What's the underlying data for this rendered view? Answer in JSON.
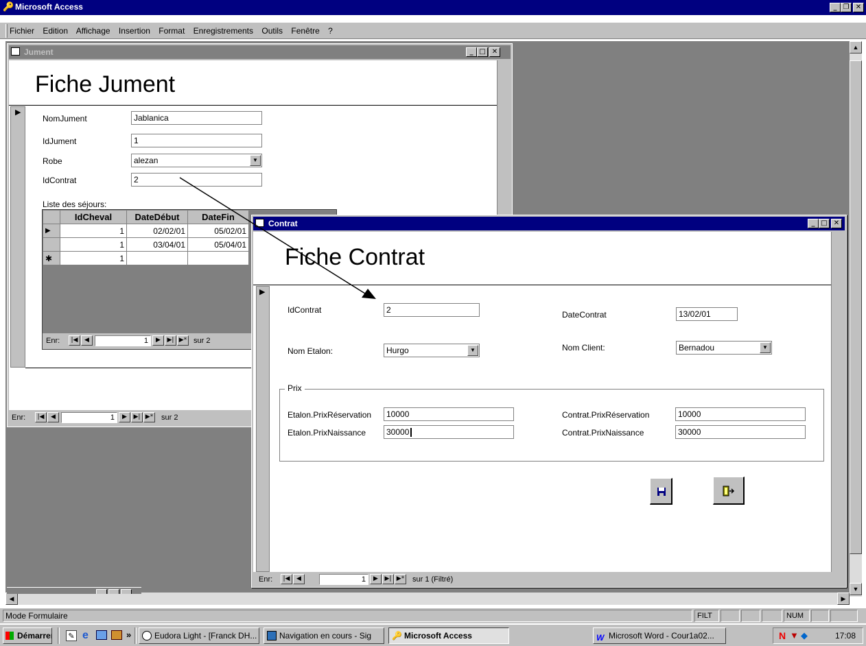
{
  "app": {
    "title": "Microsoft Access"
  },
  "menu": [
    "Fichier",
    "Edition",
    "Affichage",
    "Insertion",
    "Format",
    "Enregistrements",
    "Outils",
    "Fenêtre",
    "?"
  ],
  "jument": {
    "window_title": "Jument",
    "heading": "Fiche Jument",
    "fields": [
      {
        "label": "NomJument",
        "value": "Jablanica"
      },
      {
        "label": "IdJument",
        "value": "1"
      },
      {
        "label": "Robe",
        "value": "alezan"
      },
      {
        "label": "IdContrat",
        "value": "2"
      }
    ],
    "sejours_label": "Liste des séjours:",
    "columns": [
      "IdCheval",
      "DateDébut",
      "DateFin"
    ],
    "rows": [
      [
        "1",
        "02/02/01",
        "05/02/01"
      ],
      [
        "1",
        "03/04/01",
        "05/04/01"
      ],
      [
        "1",
        "",
        ""
      ]
    ],
    "sub_nav": {
      "label": "Enr:",
      "record": "1",
      "total": "sur 2"
    },
    "nav": {
      "label": "Enr:",
      "record": "1",
      "total": "sur 2"
    }
  },
  "contrat": {
    "window_title": "Contrat",
    "heading": "Fiche Contrat",
    "idcontrat": {
      "label": "IdContrat",
      "value": "2"
    },
    "datecontrat": {
      "label": "DateContrat",
      "value": "13/02/01"
    },
    "etalon": {
      "label": "Nom Etalon:",
      "value": "Hurgo"
    },
    "client": {
      "label": "Nom Client:",
      "value": "Bernadou"
    },
    "prix_group": "Prix",
    "etalon_resa": {
      "label": "Etalon.PrixRéservation",
      "value": "10000"
    },
    "etalon_naiss": {
      "label": "Etalon.PrixNaissance",
      "value": "30000"
    },
    "contrat_resa": {
      "label": "Contrat.PrixRéservation",
      "value": "10000"
    },
    "contrat_naiss": {
      "label": "Contrat.PrixNaissance",
      "value": "30000"
    },
    "nav": {
      "label": "Enr:",
      "record": "1",
      "total": "sur 1 (Filtré)"
    }
  },
  "statusbar": {
    "mode": "Mode Formulaire",
    "filt": "FILT",
    "num": "NUM"
  },
  "taskbar": {
    "start": "Démarrer",
    "tasks": [
      "Eudora Light - [Franck DH...",
      "Navigation en cours - Sig",
      "Microsoft Access",
      "Microsoft Word - Cour1a02..."
    ],
    "clock": "17:08"
  },
  "colors": {
    "titlebar": "#000080",
    "inactive_titlebar": "#808080",
    "face": "#c0c0c0",
    "mdi_bg": "#808080"
  }
}
